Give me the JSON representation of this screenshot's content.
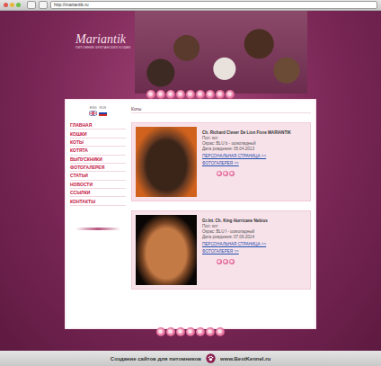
{
  "browser": {
    "url": "http://mariantik.ru"
  },
  "logo": {
    "title": "Mariantik",
    "subtitle": "ПИТОМНИК БРИТАНСКИХ КОШЕК"
  },
  "languages": [
    "ENG",
    "RUS"
  ],
  "menu": [
    "ГЛАВНАЯ",
    "КОШКИ",
    "КОТЫ",
    "КОТЯТА",
    "ВЫПУСКНИКИ",
    "ФОТОГАЛЕРЕЯ",
    "СТАТЬИ",
    "НОВОСТИ",
    "ССЫЛКИ",
    "КОНТАКТЫ"
  ],
  "page_title": "Коты",
  "cats": [
    {
      "name": "Ch. Richard Clever De Lion Fiore MARIANTIK",
      "sex": "Пол: кот",
      "color": "Окрас: BLU b - шоколадный",
      "birth": "Дата рождения: 05.04.2013",
      "links": [
        "ПЕРСОНАЛЬНАЯ СТРАНИЦА >>",
        "ФОТОГАЛЕРЕЯ >>"
      ]
    },
    {
      "name": "Gr.Int. Ch. King Hurricane Nebius",
      "sex": "Пол: кот",
      "color": "Окрас: BLU f - шоколадный",
      "birth": "Дата рождения: 07.06.2014",
      "links": [
        "ПЕРСОНАЛЬНАЯ СТРАНИЦА >>",
        "ФОТОГАЛЕРЕЯ >>"
      ]
    }
  ],
  "footer": {
    "text": "Создание сайтов для питомников",
    "site": "www.BestKennel.ru"
  }
}
